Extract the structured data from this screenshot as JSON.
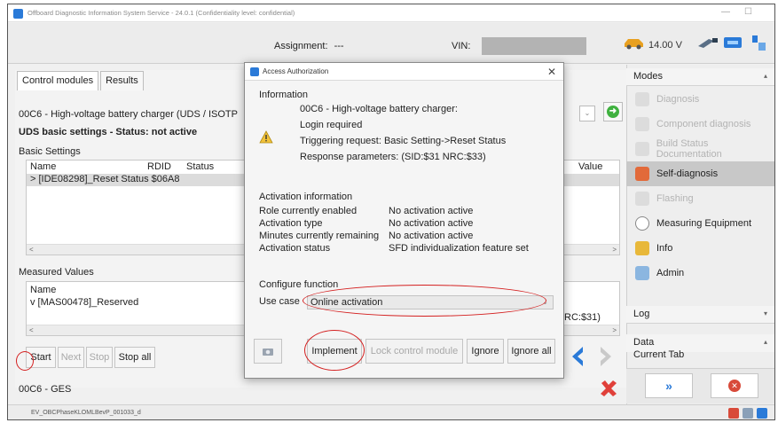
{
  "window": {
    "title": "Offboard Diagnostic Information System Service - 24.0.1 (Confidentiality level: confidential)",
    "minimize": "—",
    "maximize": "☐"
  },
  "toolbar": {
    "assignment_label": "Assignment:",
    "assignment_value": "---",
    "vin_label": "VIN:",
    "voltage": "14.00 V"
  },
  "tabs": [
    {
      "label": "Control modules"
    },
    {
      "label": "Results"
    }
  ],
  "main": {
    "module_title": "00C6 - High-voltage battery charger  (UDS / ISOTP",
    "uds_status": "UDS basic settings - Status: not active",
    "basic_settings_label": "Basic Settings",
    "columns": {
      "name": "Name",
      "rdid": "RDID",
      "status": "Status",
      "value": "Value"
    },
    "row_name": "> [IDE08298]_Reset Status $06A8",
    "measured_values_label": "Measured Values",
    "mv_name_header": "Name",
    "mv_row": "v [MAS00478]_Reserved",
    "nrc_fragment": "RC:$31)",
    "buttons": {
      "start": "Start",
      "next": "Next",
      "stop": "Stop",
      "stop_all": "Stop all"
    },
    "status_module": "00C6 - GES"
  },
  "bottombar": {
    "path": "EV_OBCPhaseKLOMLBevP_001033_d"
  },
  "right_panel": {
    "modes_header": "Modes",
    "modes": [
      {
        "label": "Diagnosis",
        "state": "disabled"
      },
      {
        "label": "Component diagnosis",
        "state": "disabled"
      },
      {
        "label": "Build Status Documentation",
        "state": "disabled"
      },
      {
        "label": "Self-diagnosis",
        "state": "active"
      },
      {
        "label": "Flashing",
        "state": "disabled"
      },
      {
        "label": "Measuring Equipment",
        "state": "normal"
      },
      {
        "label": "Info",
        "state": "normal"
      },
      {
        "label": "Admin",
        "state": "normal"
      }
    ],
    "log_header": "Log",
    "data_header": "Data",
    "current_tab": "Current Tab"
  },
  "dialog": {
    "title": "Access Authorization",
    "close": "✕",
    "information_label": "Information",
    "module": "00C6 - High-voltage battery charger:",
    "login_required": "Login required",
    "triggering": "Triggering request: Basic Setting->Reset Status",
    "response": "Response parameters: (SID:$31 NRC:$33)",
    "activation_header": "Activation information",
    "activation": [
      {
        "label": "Role currently enabled",
        "value": "No activation active"
      },
      {
        "label": "Activation type",
        "value": "No activation active"
      },
      {
        "label": "Minutes currently remaining",
        "value": "No activation active"
      },
      {
        "label": "Activation status",
        "value": "SFD individualization feature set"
      }
    ],
    "configure_label": "Configure function",
    "use_case_label": "Use case",
    "use_case_value": "Online activation",
    "buttons": {
      "implement": "Implement",
      "lock": "Lock control module",
      "ignore": "Ignore",
      "ignore_all": "Ignore all"
    }
  },
  "colors": {
    "annotation_red": "#d42020",
    "accent_blue": "#2a7ad8",
    "ok_green": "#3fb13f"
  }
}
